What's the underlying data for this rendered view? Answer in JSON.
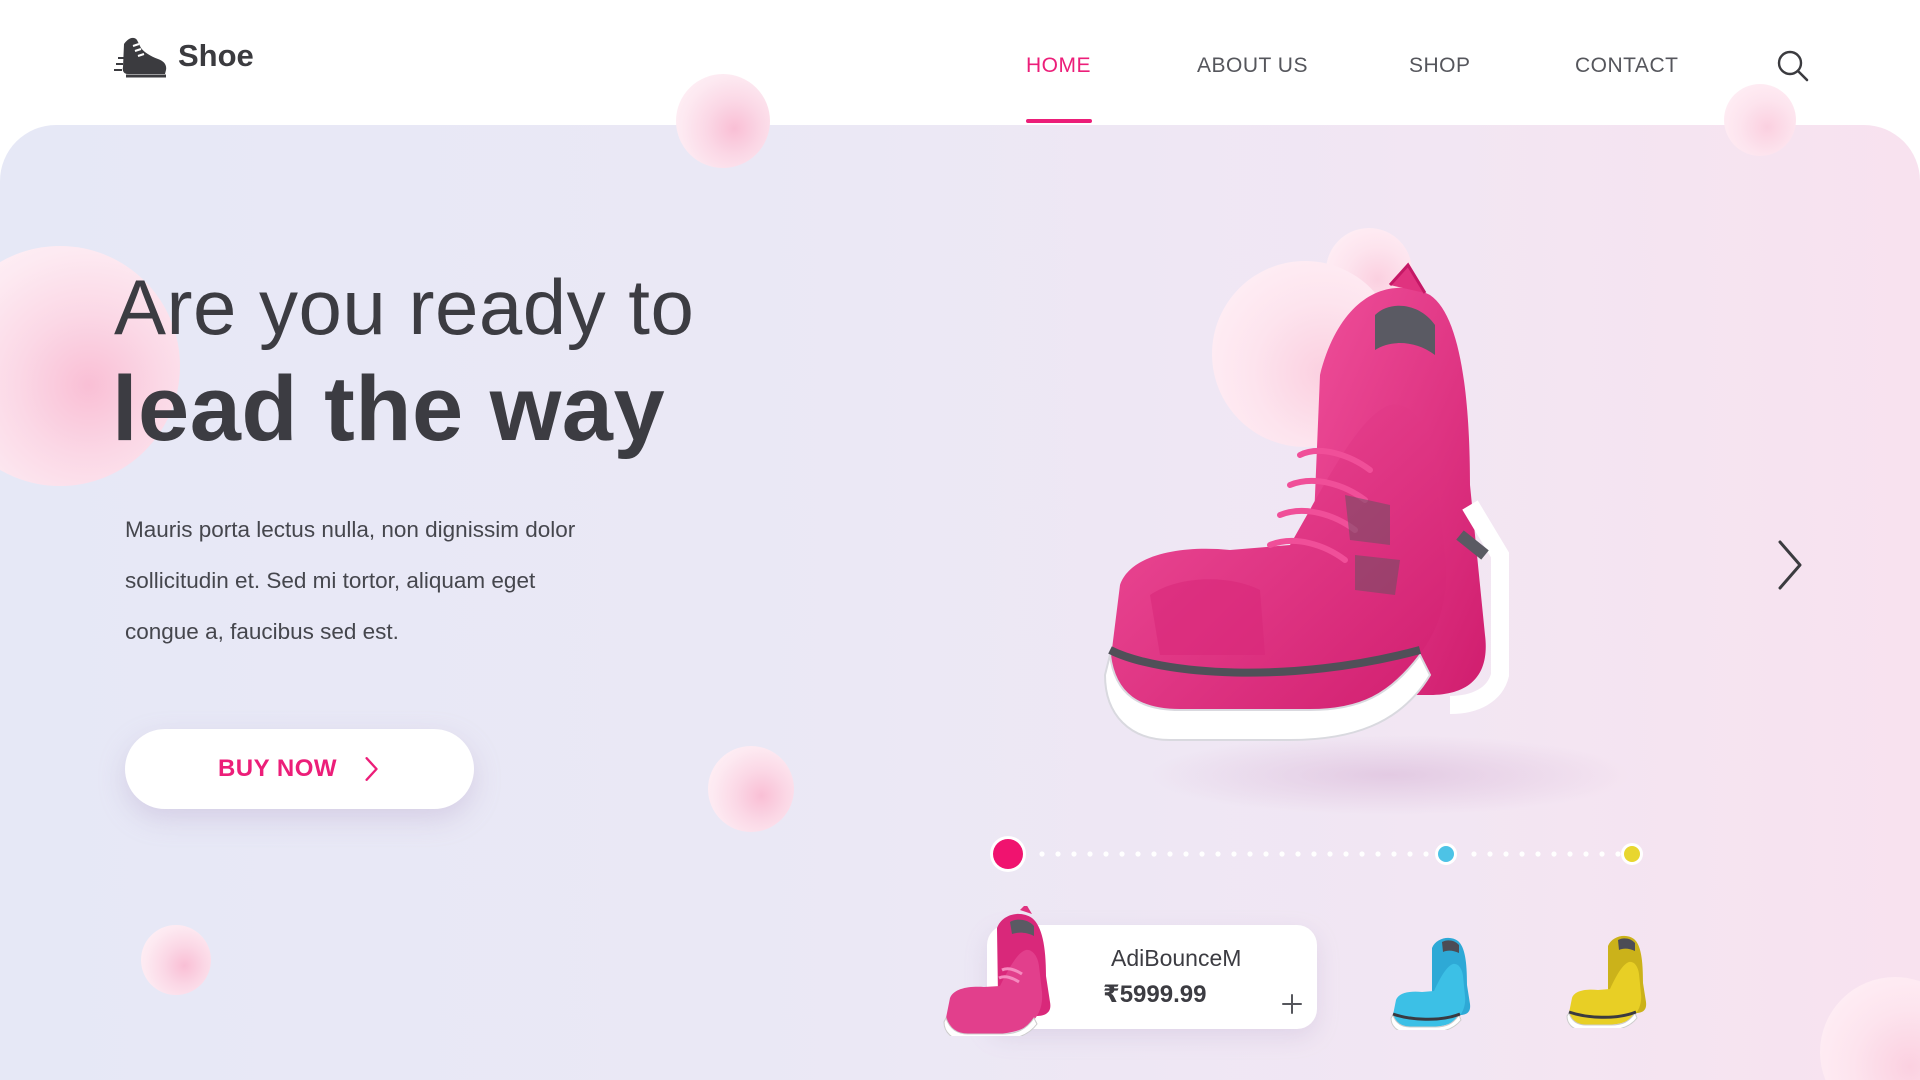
{
  "brand": {
    "name": "Shoe",
    "icon": "running-shoe-icon"
  },
  "nav": {
    "items": [
      {
        "label": "HOME",
        "active": true
      },
      {
        "label": "ABOUT US",
        "active": false
      },
      {
        "label": "SHOP",
        "active": false
      },
      {
        "label": "CONTACT",
        "active": false
      }
    ],
    "search_icon": "search-icon"
  },
  "hero": {
    "headline_line1": "Are you ready to",
    "headline_line2": "lead the way",
    "description_lines": [
      "Mauris porta lectus nulla, non dignissim dolor",
      "sollicitudin et. Sed mi tortor, aliquam eget",
      "congue a, faucibus sed est."
    ],
    "cta_label": "BUY NOW",
    "next_icon": "chevron-right-icon"
  },
  "colors": {
    "accent": "#ec1e79",
    "text": "#3c3c42",
    "slider_pink": "#f0136f",
    "slider_blue": "#4dc3e6",
    "slider_yellow": "#e8d62f"
  },
  "slider": {
    "stops": [
      {
        "color": "pink",
        "selected": true
      },
      {
        "color": "blue",
        "selected": false
      },
      {
        "color": "yellow",
        "selected": false
      }
    ]
  },
  "products": [
    {
      "name": "AdiBounceM",
      "price": "₹5999.99",
      "color": "pink",
      "selected": true,
      "add_icon": "plus-icon"
    },
    {
      "color": "blue",
      "selected": false
    },
    {
      "color": "yellow",
      "selected": false
    }
  ]
}
